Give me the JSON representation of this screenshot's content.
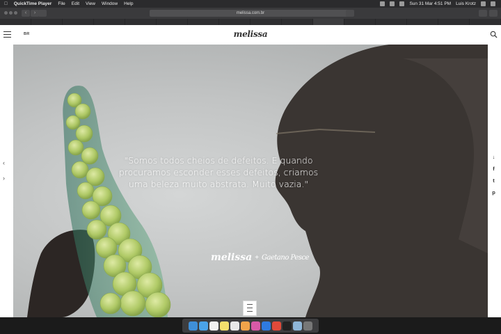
{
  "menubar": {
    "app_name": "QuickTime Player",
    "menus": [
      "File",
      "Edit",
      "View",
      "Window",
      "Help"
    ],
    "datetime": "Sun 31 Mar  4:51 PM",
    "user": "Luis Krotz"
  },
  "browser": {
    "url": "melissa.com.br",
    "tabs": [
      "",
      "",
      "",
      "",
      "",
      "",
      "",
      "",
      "",
      "",
      "",
      "",
      "",
      "",
      "",
      "",
      "",
      ""
    ]
  },
  "site": {
    "language": "BR",
    "brand": "melissa",
    "hero": {
      "quote": "\"Somos todos cheios de defeitos. E quando procuramos esconder esses defeitos, criamos uma beleza muito abstrata. Muito vazia.\"",
      "collab_logo": "melissa",
      "collab_plus": "+",
      "collab_signature": "Gaetano Pesce"
    },
    "nav": {
      "prev": "‹",
      "next": "›"
    },
    "share": {
      "down": "↓",
      "facebook": "f",
      "twitter": "t",
      "pinterest": "p"
    }
  },
  "colors": {
    "hero_bg": "#c2c4c4",
    "resin_green": "#b9d46a",
    "silhouette": "#3a3532"
  },
  "dock_icons": [
    "finder-icon",
    "safari-icon",
    "calendar-icon",
    "notes-icon",
    "reminders-icon",
    "photos-icon",
    "itunes-icon",
    "appstore-icon",
    "chrome-icon",
    "terminal-icon",
    "preview-icon",
    "trash-icon"
  ]
}
